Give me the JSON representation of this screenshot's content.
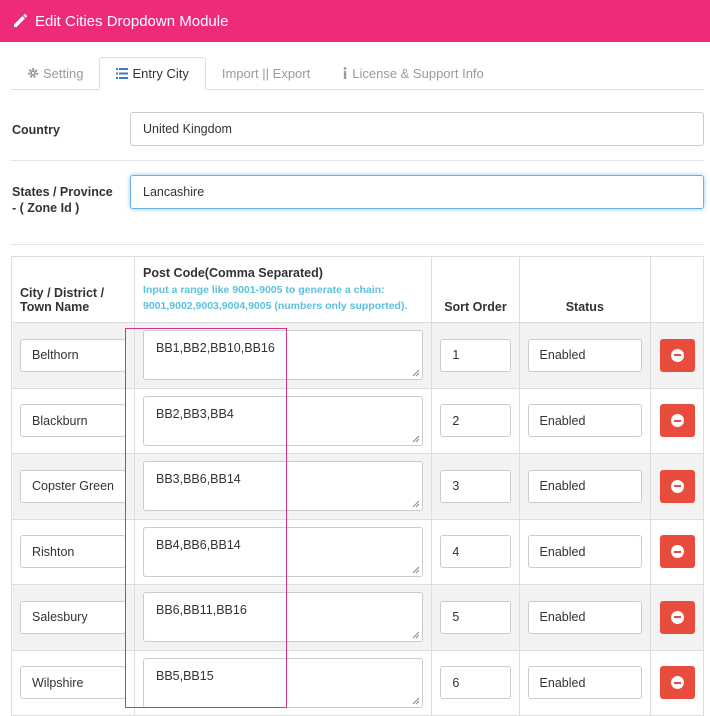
{
  "header": {
    "title": "Edit Cities Dropdown Module",
    "icon": "pencil-icon"
  },
  "tabs": [
    {
      "label": "Setting",
      "icon": "gear-icon",
      "active": false
    },
    {
      "label": "Entry City",
      "icon": "list-icon",
      "active": true
    },
    {
      "label": "Import || Export",
      "icon": "",
      "active": false
    },
    {
      "label": "License & Support Info",
      "icon": "info-icon",
      "active": false
    }
  ],
  "country": {
    "label": "Country",
    "value": "United Kingdom"
  },
  "state": {
    "label": "States / Province - ( Zone Id )",
    "value": "Lancashire"
  },
  "table": {
    "headers": {
      "city": "City / District / Town Name",
      "postcode": "Post Code(Comma Separated)",
      "hint": "Input a range like 9001-9005 to generate a chain: 9001,9002,9003,9004,9005 (numbers only supported).",
      "sort": "Sort Order",
      "status": "Status"
    },
    "rows": [
      {
        "city": "Belthorn",
        "postcodes": "BB1,BB2,BB10,BB16",
        "sort": "1",
        "status": "Enabled"
      },
      {
        "city": "Blackburn",
        "postcodes": "BB2,BB3,BB4",
        "sort": "2",
        "status": "Enabled"
      },
      {
        "city": "Copster Green",
        "postcodes": "BB3,BB6,BB14",
        "sort": "3",
        "status": "Enabled"
      },
      {
        "city": "Rishton",
        "postcodes": "BB4,BB6,BB14",
        "sort": "4",
        "status": "Enabled"
      },
      {
        "city": "Salesbury",
        "postcodes": "BB6,BB11,BB16",
        "sort": "5",
        "status": "Enabled"
      },
      {
        "city": "Wilpshire",
        "postcodes": "BB5,BB15",
        "sort": "6",
        "status": "Enabled"
      }
    ]
  },
  "colors": {
    "header": "#ee2a7b",
    "delete": "#e74c3c",
    "hint": "#5bc0de",
    "highlight": "#d63384"
  }
}
